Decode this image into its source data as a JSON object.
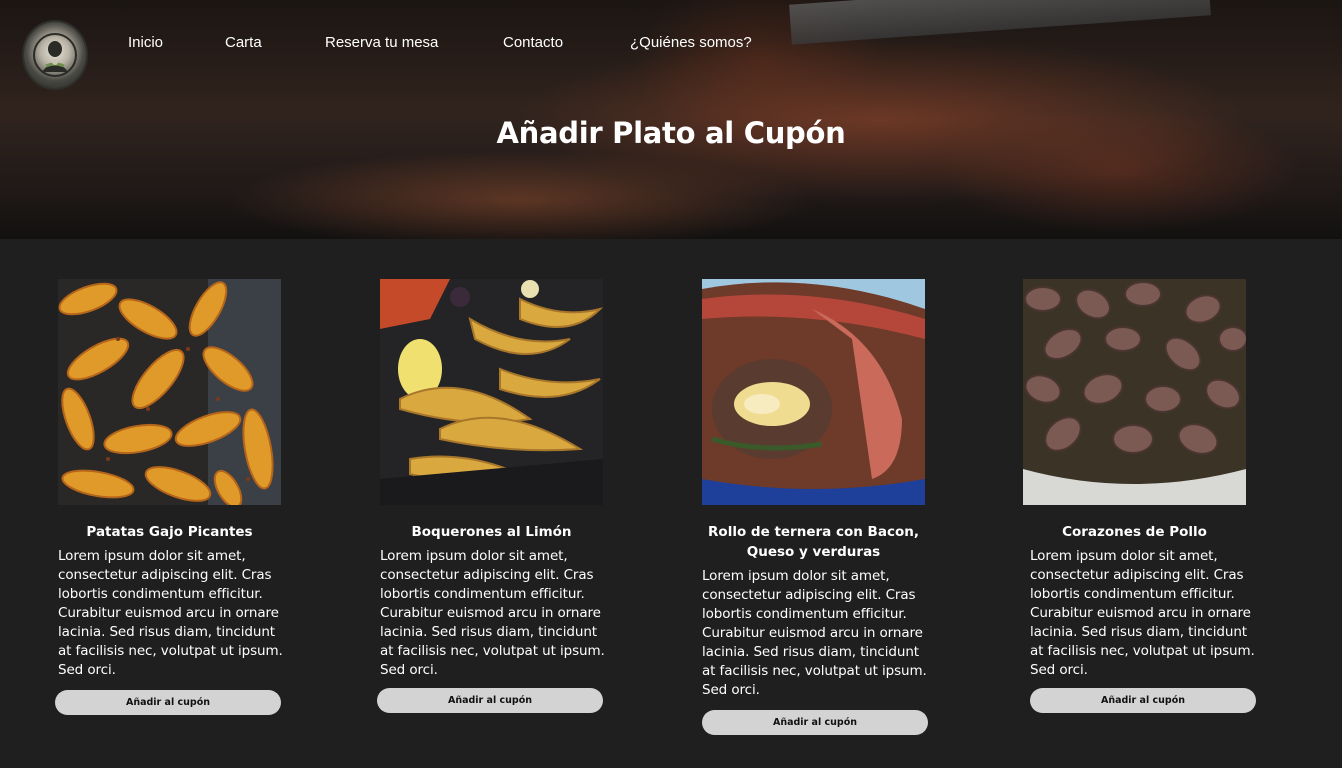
{
  "header": {
    "logo_icon": "restaurant-logo-icon",
    "nav": [
      {
        "label": "Inicio"
      },
      {
        "label": "Carta"
      },
      {
        "label": "Reserva tu mesa"
      },
      {
        "label": "Contacto"
      },
      {
        "label": "¿Quiénes somos?"
      }
    ],
    "title": "Añadir Plato al Cupón"
  },
  "dishes": [
    {
      "name": "Patatas Gajo Picantes",
      "description": "Lorem ipsum dolor sit amet, consectetur adipiscing elit. Cras lobortis condimentum efficitur. Curabitur euismod arcu in ornare lacinia. Sed risus diam, tincidunt at facilisis nec, volutpat ut ipsum. Sed orci.",
      "button_label": "Añadir al cupón",
      "image": "spicy-potato-wedges"
    },
    {
      "name": "Boquerones al Limón",
      "description": "Lorem ipsum dolor sit amet, consectetur adipiscing elit. Cras lobortis condimentum efficitur. Curabitur euismod arcu in ornare lacinia. Sed risus diam, tincidunt at facilisis nec, volutpat ut ipsum. Sed orci.",
      "button_label": "Añadir al cupón",
      "image": "fried-anchovies-with-lemon"
    },
    {
      "name": "Rollo de ternera con Bacon, Queso y verduras",
      "description": "Lorem ipsum dolor sit amet, consectetur adipiscing elit. Cras lobortis condimentum efficitur. Curabitur euismod arcu in ornare lacinia. Sed risus diam, tincidunt at facilisis nec, volutpat ut ipsum. Sed orci.",
      "button_label": "Añadir al cupón",
      "image": "beef-roll-bacon-cheese"
    },
    {
      "name": "Corazones de Pollo",
      "description": "Lorem ipsum dolor sit amet, consectetur adipiscing elit. Cras lobortis condimentum efficitur. Curabitur euismod arcu in ornare lacinia. Sed risus diam, tincidunt at facilisis nec, volutpat ut ipsum. Sed orci.",
      "button_label": "Añadir al cupón",
      "image": "chicken-hearts"
    }
  ],
  "colors": {
    "background": "#1f1f1f",
    "button": "#d3d3d3",
    "text": "#ffffff"
  }
}
